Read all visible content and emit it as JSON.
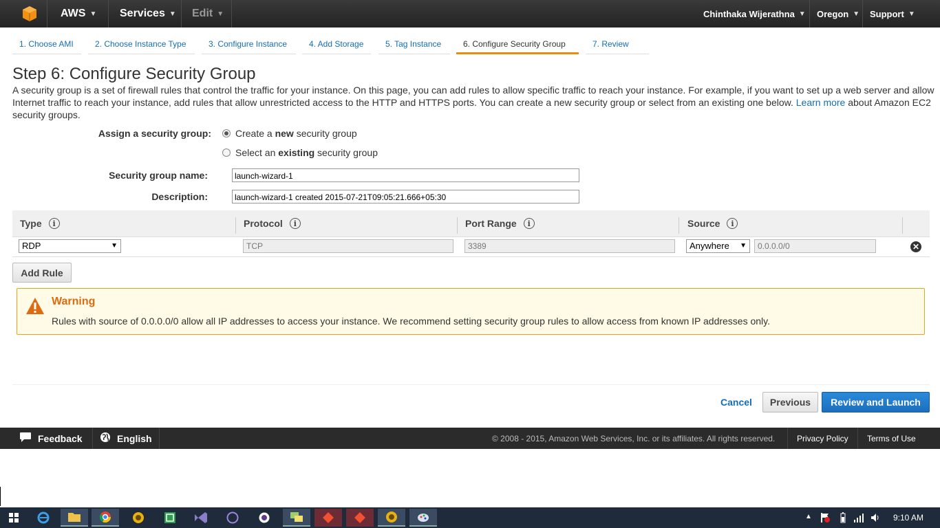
{
  "topnav": {
    "brand": "AWS",
    "services": "Services",
    "edit": "Edit",
    "user": "Chinthaka Wijerathna",
    "region": "Oregon",
    "support": "Support"
  },
  "wizard_tabs": [
    {
      "label": "1. Choose AMI"
    },
    {
      "label": "2. Choose Instance Type"
    },
    {
      "label": "3. Configure Instance"
    },
    {
      "label": "4. Add Storage"
    },
    {
      "label": "5. Tag Instance"
    },
    {
      "label": "6. Configure Security Group"
    },
    {
      "label": "7. Review"
    }
  ],
  "active_tab": "6. Configure Security Group",
  "page": {
    "title": "Step 6: Configure Security Group",
    "intro_1": "A security group is a set of firewall rules that control the traffic for your instance. On this page, you can add rules to allow specific traffic to reach your instance. For example, if you want to set up a web server and allow Internet traffic to reach your instance, add rules that allow unrestricted access to the HTTP and HTTPS ports. You can create a new security group or select from an existing one below.",
    "learn_more": "Learn more",
    "intro_2": "about Amazon EC2 security groups."
  },
  "form": {
    "assign_label": "Assign a security group:",
    "radio_create_pre": "Create a ",
    "radio_create_bold": "new",
    "radio_create_post": " security group",
    "radio_select_pre": "Select an ",
    "radio_select_bold": "existing",
    "radio_select_post": " security group",
    "selected": "create",
    "name_label": "Security group name:",
    "name_value": "launch-wizard-1",
    "desc_label": "Description:",
    "desc_value": "launch-wizard-1 created 2015-07-21T09:05:21.666+05:30"
  },
  "rules_table": {
    "headers": [
      "Type",
      "Protocol",
      "Port Range",
      "Source"
    ],
    "rows": [
      {
        "type": "RDP",
        "protocol": "TCP",
        "port_range": "3389",
        "source_option": "Anywhere",
        "source_cidr": "0.0.0.0/0"
      }
    ],
    "add_rule": "Add Rule"
  },
  "warning": {
    "title": "Warning",
    "message": "Rules with source of 0.0.0.0/0 allow all IP addresses to access your instance. We recommend setting security group rules to allow access from known IP addresses only."
  },
  "actions": {
    "cancel": "Cancel",
    "previous": "Previous",
    "review_launch": "Review and Launch"
  },
  "footer": {
    "feedback": "Feedback",
    "language": "English",
    "copyright": "© 2008 - 2015, Amazon Web Services, Inc. or its affiliates. All rights reserved.",
    "privacy": "Privacy Policy",
    "terms": "Terms of Use"
  },
  "taskbar": {
    "clock": "9:10 AM",
    "apps": [
      "start-icon",
      "internet-explorer-icon",
      "file-explorer-icon",
      "chrome-icon",
      "media-icon",
      "spreadsheet-icon",
      "visual-studio-icon",
      "viber-icon",
      "app-icon",
      "chat-icon",
      "git-icon",
      "git-icon",
      "media-icon",
      "paint-icon"
    ]
  },
  "colors": {
    "accent_orange": "#e48f0f",
    "link_blue": "#146eb4",
    "primary_button": "#1b6fbe",
    "warning_border": "#e7a31c",
    "warning_title": "#dd6b10"
  }
}
